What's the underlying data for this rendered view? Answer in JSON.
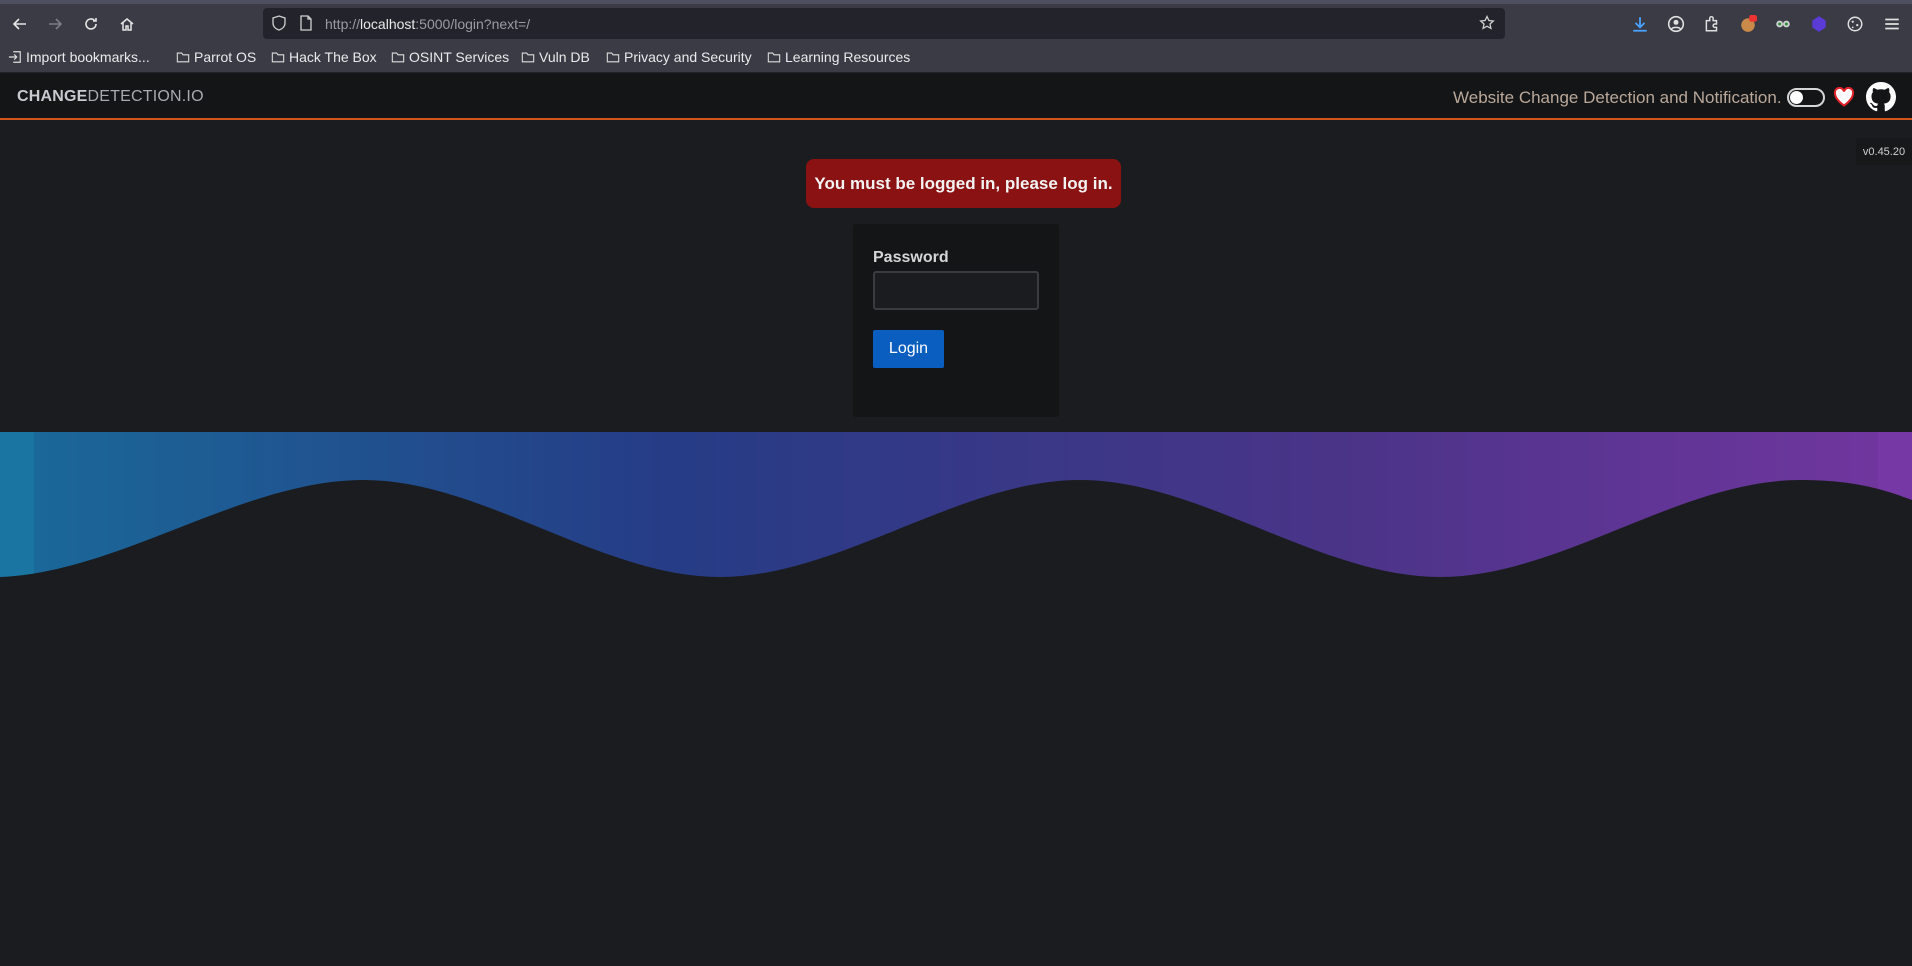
{
  "browser": {
    "url_scheme": "http://",
    "url_host": "localhost",
    "url_rest": ":5000/login?next=/",
    "bookmarks": [
      {
        "label": "Import bookmarks...",
        "icon": "import-icon"
      },
      {
        "label": "Parrot OS",
        "icon": "folder-icon"
      },
      {
        "label": "Hack The Box",
        "icon": "folder-icon"
      },
      {
        "label": "OSINT Services",
        "icon": "folder-icon"
      },
      {
        "label": "Vuln DB",
        "icon": "folder-icon"
      },
      {
        "label": "Privacy and Security",
        "icon": "folder-icon"
      },
      {
        "label": "Learning Resources",
        "icon": "folder-icon"
      }
    ]
  },
  "header": {
    "brand_bold": "CHANGE",
    "brand_rest": "DETECTION.IO",
    "tagline": "Website Change Detection and Notification.",
    "version": "v0.45.20"
  },
  "main": {
    "flash_message": "You must be logged in, please log in.",
    "password_label": "Password",
    "password_value": "",
    "login_button": "Login"
  },
  "colors": {
    "accent_orange": "#d3551b",
    "flash_red": "#8a1212",
    "button_blue": "#0a5ec0",
    "wave_start": "#1a7aa8",
    "wave_mid": "#2b3b86",
    "wave_end": "#7a3aa0"
  }
}
